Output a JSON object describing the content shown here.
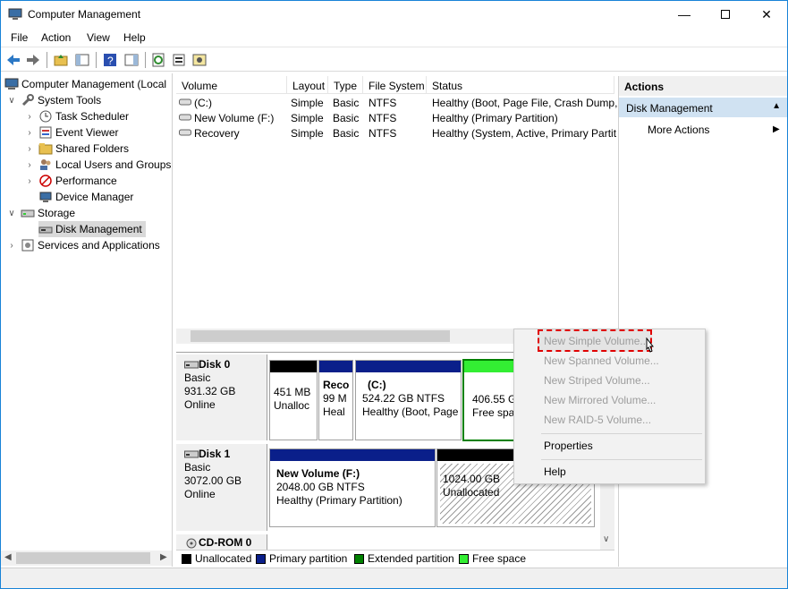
{
  "window": {
    "title": "Computer Management"
  },
  "menu": [
    "File",
    "Action",
    "View",
    "Help"
  ],
  "tree": {
    "root": "Computer Management (Local",
    "system_tools": "System Tools",
    "task_scheduler": "Task Scheduler",
    "event_viewer": "Event Viewer",
    "shared_folders": "Shared Folders",
    "local_users": "Local Users and Groups",
    "performance": "Performance",
    "device_manager": "Device Manager",
    "storage": "Storage",
    "disk_management": "Disk Management",
    "services": "Services and Applications"
  },
  "volumes": {
    "headers": [
      "Volume",
      "Layout",
      "Type",
      "File System",
      "Status"
    ],
    "rows": [
      [
        "(C:)",
        "Simple",
        "Basic",
        "NTFS",
        "Healthy (Boot, Page File, Crash Dump,"
      ],
      [
        "New Volume (F:)",
        "Simple",
        "Basic",
        "NTFS",
        "Healthy (Primary Partition)"
      ],
      [
        "Recovery",
        "Simple",
        "Basic",
        "NTFS",
        "Healthy (System, Active, Primary Partit"
      ]
    ]
  },
  "disk0": {
    "name": "Disk 0",
    "type": "Basic",
    "size": "931.32 GB",
    "status": "Online",
    "p1": {
      "size": "451 MB",
      "status": "Unalloc"
    },
    "p2": {
      "name": "Reco",
      "size": "99 M",
      "status": "Heal"
    },
    "p3": {
      "name": "(C:)",
      "size": "524.22 GB NTFS",
      "status": "Healthy (Boot, Page"
    },
    "p4": {
      "size": "406.55 G",
      "status": "Free spa"
    }
  },
  "disk1": {
    "name": "Disk 1",
    "type": "Basic",
    "size": "3072.00 GB",
    "status": "Online",
    "p1": {
      "name": "New Volume  (F:)",
      "size": "2048.00 GB NTFS",
      "status": "Healthy (Primary Partition)"
    },
    "p2": {
      "size": "1024.00 GB",
      "status": "Unallocated"
    }
  },
  "cdrom": {
    "name": "CD-ROM 0"
  },
  "legend": [
    {
      "label": "Unallocated",
      "color": "#000000"
    },
    {
      "label": "Primary partition",
      "color": "#0a1f8a"
    },
    {
      "label": "Extended partition",
      "color": "#008000"
    },
    {
      "label": "Free space",
      "color": "#33ee33"
    }
  ],
  "actions": {
    "header": "Actions",
    "section": "Disk Management",
    "more": "More Actions"
  },
  "context_menu": {
    "new_simple": "New Simple Volume...",
    "new_spanned": "New Spanned Volume...",
    "new_striped": "New Striped Volume...",
    "new_mirrored": "New Mirrored Volume...",
    "new_raid5": "New RAID-5 Volume...",
    "properties": "Properties",
    "help": "Help"
  }
}
